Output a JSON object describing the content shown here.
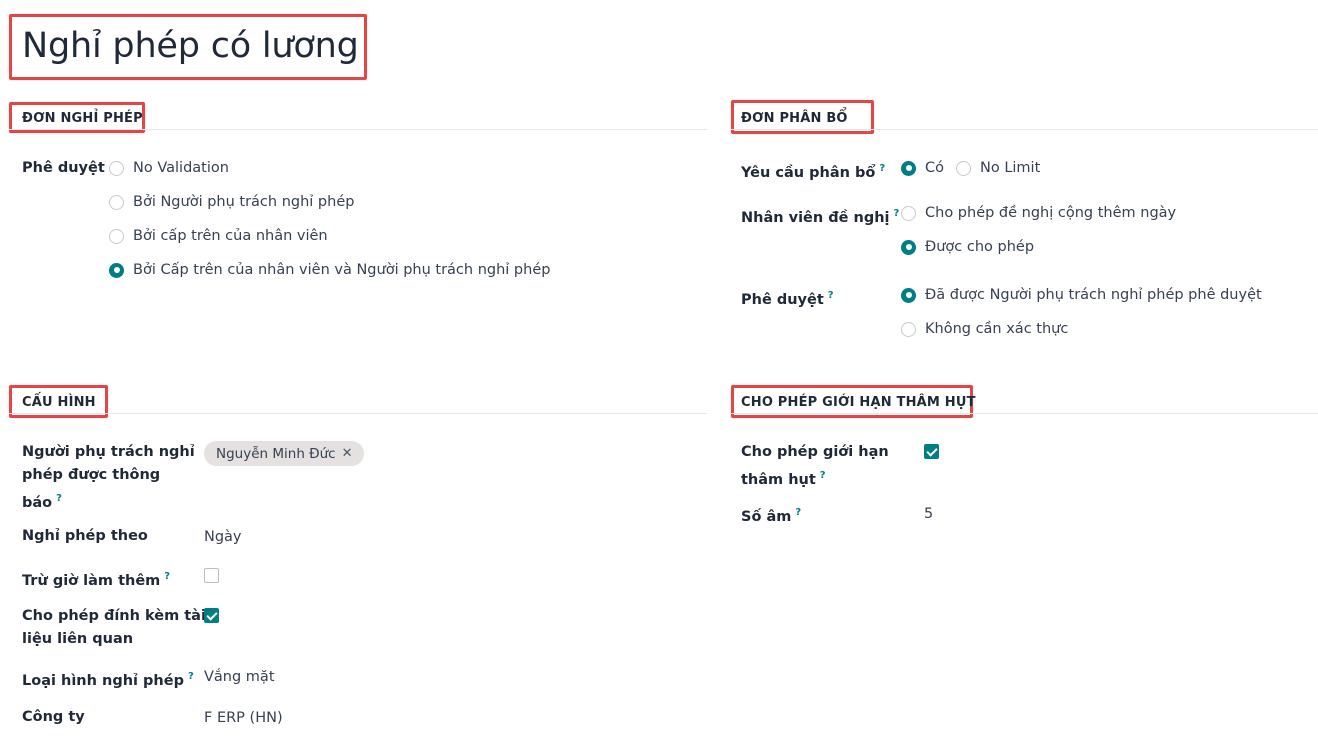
{
  "title": "Nghỉ phép có lương",
  "leave_requests": {
    "heading": "ĐƠN NGHỈ PHÉP",
    "approval_label": "Phê duyệt",
    "approval_options": [
      "No Validation",
      "Bởi Người phụ trách nghỉ phép",
      "Bởi cấp trên của nhân viên",
      "Bởi Cấp trên của nhân viên và Người phụ trách nghỉ phép"
    ],
    "approval_selected_index": 3
  },
  "allocation": {
    "heading": "ĐƠN PHÂN BỔ",
    "requires_label": "Yêu cầu phân bổ",
    "requires_options": [
      "Có",
      "No Limit"
    ],
    "requires_selected_index": 0,
    "employee_label": "Nhân viên đề nghị",
    "employee_options": [
      "Cho phép đề nghị cộng thêm ngày",
      "Được cho phép"
    ],
    "employee_selected_index": 1,
    "approval_label": "Phê duyệt",
    "approval_options": [
      "Đã được Người phụ trách nghỉ phép phê duyệt",
      "Không cần xác thực"
    ],
    "approval_selected_index": 0
  },
  "config": {
    "heading": "CẤU HÌNH",
    "notified_label_line1": "Người phụ trách nghỉ",
    "notified_label_line2": "phép được thông",
    "notified_label_line3": "báo",
    "notified_tag": "Nguyễn Minh Đức",
    "leave_unit_label": "Nghỉ phép theo",
    "leave_unit_value": "Ngày",
    "deduct_overtime_label": "Trừ giờ làm thêm",
    "deduct_overtime_checked": false,
    "attach_label_line1": "Cho phép đính kèm tài",
    "attach_label_line2": "liệu liên quan",
    "attach_checked": true,
    "leave_kind_label": "Loại hình nghỉ phép",
    "leave_kind_value": "Vắng mặt",
    "company_label": "Công ty",
    "company_value": "F ERP (HN)"
  },
  "negative": {
    "heading": "CHO PHÉP GIỚI HẠN THÂM HỤT",
    "allow_label_line1": "Cho phép giới hạn",
    "allow_label_line2": "thâm hụt",
    "allow_checked": true,
    "amount_label": "Số âm",
    "amount_value": "5"
  },
  "help_marker": "?",
  "remove_glyph": "✕",
  "colors": {
    "accent": "#017e84",
    "highlight": "#e04848"
  }
}
